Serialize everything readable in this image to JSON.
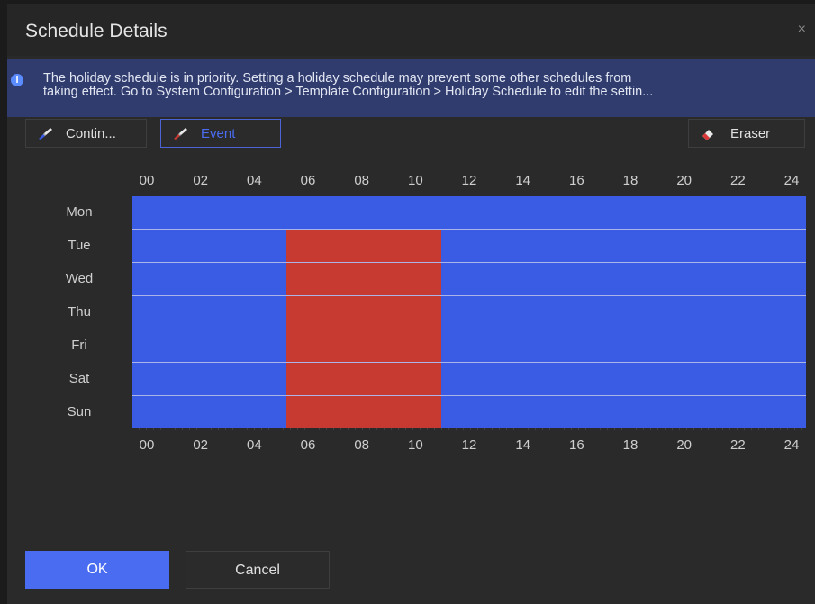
{
  "dialog": {
    "title": "Schedule Details",
    "close_symbol": "×"
  },
  "banner": {
    "icon": "info-icon",
    "text_line1": "The holiday schedule is in priority. Setting a holiday schedule may prevent some other schedules from",
    "text_line2": "taking effect. Go to System Configuration > Template Configuration > Holiday Schedule to edit the settin..."
  },
  "toolbar": {
    "continuous_label": "Contin...",
    "event_label": "Event",
    "eraser_label": "Eraser",
    "selected_tool": "Event"
  },
  "hour_labels": [
    "00",
    "02",
    "04",
    "06",
    "08",
    "10",
    "12",
    "14",
    "16",
    "18",
    "20",
    "22",
    "24"
  ],
  "days": [
    "Mon",
    "Tue",
    "Wed",
    "Thu",
    "Fri",
    "Sat",
    "Sun"
  ],
  "colors": {
    "continuous": "#3a5be3",
    "event": "#c63a32",
    "accent": "#4a6cf0"
  },
  "schedule": [
    {
      "day": "Mon",
      "segments": [
        {
          "start": 0,
          "end": 24,
          "type": "continuous"
        }
      ]
    },
    {
      "day": "Tue",
      "segments": [
        {
          "start": 0,
          "end": 5.5,
          "type": "continuous"
        },
        {
          "start": 5.5,
          "end": 11,
          "type": "event"
        },
        {
          "start": 11,
          "end": 24,
          "type": "continuous"
        }
      ]
    },
    {
      "day": "Wed",
      "segments": [
        {
          "start": 0,
          "end": 5.5,
          "type": "continuous"
        },
        {
          "start": 5.5,
          "end": 11,
          "type": "event"
        },
        {
          "start": 11,
          "end": 24,
          "type": "continuous"
        }
      ]
    },
    {
      "day": "Thu",
      "segments": [
        {
          "start": 0,
          "end": 5.5,
          "type": "continuous"
        },
        {
          "start": 5.5,
          "end": 11,
          "type": "event"
        },
        {
          "start": 11,
          "end": 24,
          "type": "continuous"
        }
      ]
    },
    {
      "day": "Fri",
      "segments": [
        {
          "start": 0,
          "end": 5.5,
          "type": "continuous"
        },
        {
          "start": 5.5,
          "end": 11,
          "type": "event"
        },
        {
          "start": 11,
          "end": 24,
          "type": "continuous"
        }
      ]
    },
    {
      "day": "Sat",
      "segments": [
        {
          "start": 0,
          "end": 5.5,
          "type": "continuous"
        },
        {
          "start": 5.5,
          "end": 11,
          "type": "event"
        },
        {
          "start": 11,
          "end": 24,
          "type": "continuous"
        }
      ]
    },
    {
      "day": "Sun",
      "segments": [
        {
          "start": 0,
          "end": 5.5,
          "type": "continuous"
        },
        {
          "start": 5.5,
          "end": 11,
          "type": "event"
        },
        {
          "start": 11,
          "end": 24,
          "type": "continuous"
        }
      ]
    }
  ],
  "buttons": {
    "ok_label": "OK",
    "cancel_label": "Cancel"
  }
}
